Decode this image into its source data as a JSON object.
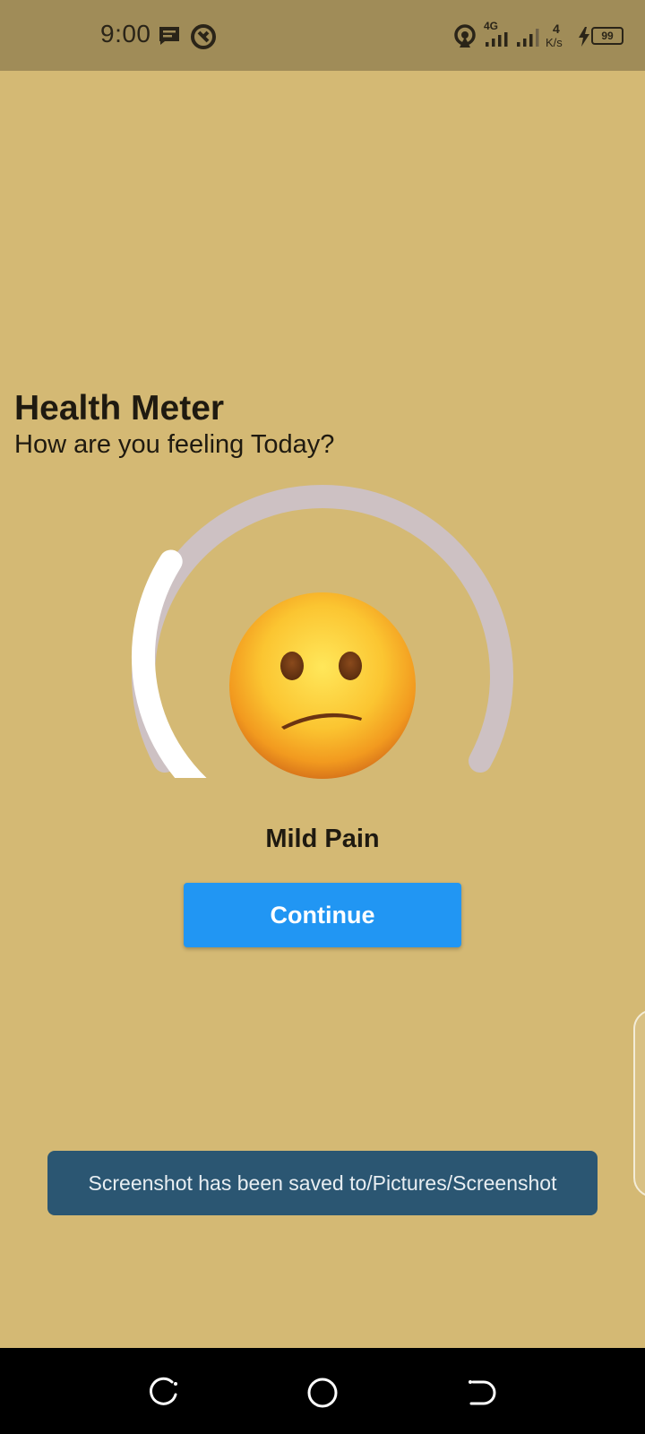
{
  "status_bar": {
    "time": "9:00",
    "network_type": "4G",
    "speed_value": "4",
    "speed_unit": "K/s",
    "battery": "99",
    "icons": [
      "message-icon",
      "vpn-icon",
      "hotspot-icon",
      "signal-icon",
      "signal-icon",
      "charging-icon",
      "battery-icon"
    ]
  },
  "header": {
    "title": "Health Meter",
    "subtitle": "How are you feeling Today?"
  },
  "meter": {
    "level": 0.3,
    "mood_label": "Mild Pain",
    "emoji": "slightly-frowning-face",
    "colors": {
      "progress": "#ffffff",
      "track": "#cdc1c3",
      "background": "#d4b974"
    }
  },
  "actions": {
    "continue_label": "Continue",
    "button_color": "#2196f3"
  },
  "toast": {
    "message": "Screenshot has been saved to/Pictures/Screenshot"
  },
  "nav_bar": {
    "icons": [
      "recents-icon",
      "home-icon",
      "back-icon"
    ]
  }
}
